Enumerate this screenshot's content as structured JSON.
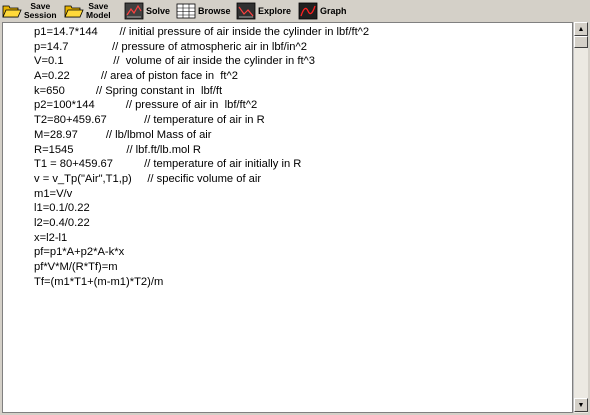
{
  "toolbar": {
    "save_session": "Save\nSession",
    "save_model": "Save\nModel",
    "solve": "Solve",
    "browse": "Browse",
    "explore": "Explore",
    "graph": "Graph"
  },
  "icons": {
    "save_session": "folder-open-icon",
    "save_model": "folder-open-icon",
    "solve": "solve-calculator-icon",
    "browse": "table-grid-icon",
    "explore": "explore-chart-icon",
    "graph": "graph-plot-icon"
  },
  "colors": {
    "toolbar_bg": "#d4d0c8",
    "editor_bg": "#ffffff",
    "folder": "#f0c000",
    "graph_line": "#ff0000"
  },
  "editor": {
    "lines": [
      "p1=14.7*144       // initial pressure of air inside the cylinder in lbf/ft^2",
      "p=14.7              // pressure of atmospheric air in lbf/in^2",
      "V=0.1                //  volume of air inside the cylinder in ft^3",
      "A=0.22          // area of piston face in  ft^2",
      "k=650          // Spring constant in  lbf/ft",
      "p2=100*144          // pressure of air in  lbf/ft^2",
      "T2=80+459.67            // temperature of air in R",
      "M=28.97         // lb/lbmol Mass of air",
      "R=1545                 // lbf.ft/lb.mol R",
      "T1 = 80+459.67          // temperature of air initially in R",
      "v = v_Tp(\"Air\",T1,p)     // specific volume of air",
      "m1=V/v",
      "l1=0.1/0.22",
      "l2=0.4/0.22",
      "x=l2-l1",
      "pf=p1*A+p2*A-k*x",
      "pf*V*M/(R*Tf)=m",
      "Tf=(m1*T1+(m-m1)*T2)/m"
    ]
  }
}
